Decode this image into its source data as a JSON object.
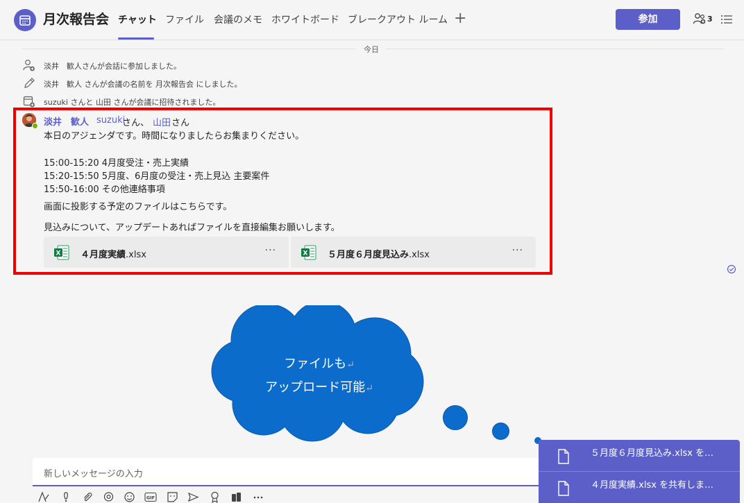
{
  "header": {
    "title": "月次報告会",
    "tabs": [
      {
        "label": "チャット"
      },
      {
        "label": "ファイル"
      },
      {
        "label": "会議のメモ"
      },
      {
        "label": "ホワイトボード"
      },
      {
        "label": "ブレークアウト ルーム"
      }
    ],
    "add_tab_symbol": "+",
    "join_label": "参加",
    "participant_count": "3"
  },
  "feed": {
    "date_label": "今日",
    "system_messages": [
      {
        "icon": "person-add-icon",
        "text": "淡井　歓人さんが会話に参加しました。"
      },
      {
        "icon": "pencil-icon",
        "text": "淡井　歓人 さんが会議の名前を 月次報告会 にしました。"
      },
      {
        "icon": "calendar-add-icon",
        "text": "suzuki さんと 山田 さんが会議に招待されました。"
      }
    ]
  },
  "message": {
    "author": "淡井　歓人",
    "mention1": "suzuki",
    "mention1_suffix": "さん、",
    "mention2": "山田",
    "mention2_suffix": "さん",
    "lines": [
      "本日のアジェンダです。時間になりましたらお集まりください。",
      "15:00-15:20 4月度受注・売上実績",
      "15:20-15:50 5月度、6月度の受注・売上見込 主要案件",
      "15:50-16:00 その他連絡事項",
      "画面に投影する予定のファイルはこちらです。",
      "見込みについて、アップデートあればファイルを直接編集お願いします。"
    ],
    "attachments": [
      {
        "name": "４月度実績",
        "ext": ".xlsx"
      },
      {
        "name": "５月度６月度見込み",
        "ext": ".xlsx"
      }
    ],
    "more_symbol": "···"
  },
  "callout": {
    "line1": "ファイルも",
    "line2": "アップロード可能",
    "return_mark": "↵",
    "fill_color": "#0c6ccc"
  },
  "compose": {
    "placeholder": "新しいメッセージの入力"
  },
  "toast": {
    "items": [
      {
        "text": "５月度６月度見込み.xlsx を…"
      },
      {
        "text": "４月度実績.xlsx を共有しま…"
      }
    ]
  },
  "colors": {
    "accent": "#5b5fc7",
    "highlight_border": "#ee0000"
  }
}
